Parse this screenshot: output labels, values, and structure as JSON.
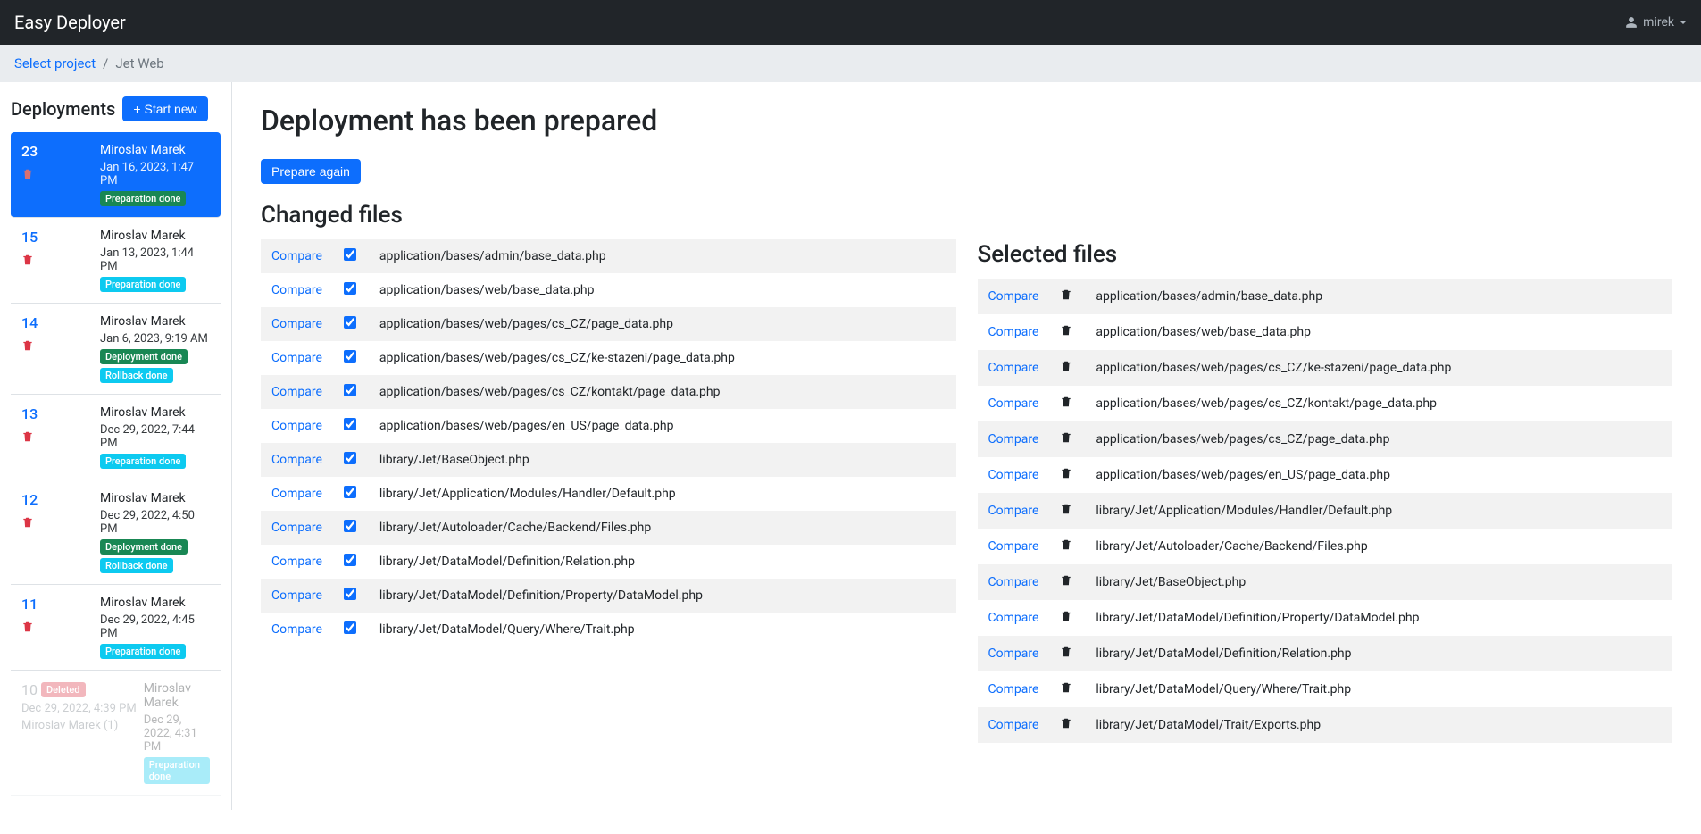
{
  "navbar": {
    "brand": "Easy Deployer",
    "user": "mirek"
  },
  "breadcrumb": {
    "select_project": "Select project",
    "separator": "/",
    "current": "Jet Web"
  },
  "sidebar": {
    "title": "Deployments",
    "start_new": "Start new",
    "deployments": [
      {
        "id": "23",
        "author": "Miroslav Marek",
        "date": "Jan 16, 2023, 1:47 PM",
        "badges": [
          {
            "text": "Preparation done",
            "cls": "badge-green"
          }
        ],
        "selected": true
      },
      {
        "id": "15",
        "author": "Miroslav Marek",
        "date": "Jan 13, 2023, 1:44 PM",
        "badges": [
          {
            "text": "Preparation done",
            "cls": "badge-teal"
          }
        ]
      },
      {
        "id": "14",
        "author": "Miroslav Marek",
        "date": "Jan 6, 2023, 9:19 AM",
        "badges": [
          {
            "text": "Deployment done",
            "cls": "badge-green"
          },
          {
            "text": "Rollback done",
            "cls": "badge-teal"
          }
        ]
      },
      {
        "id": "13",
        "author": "Miroslav Marek",
        "date": "Dec 29, 2022, 7:44 PM",
        "badges": [
          {
            "text": "Preparation done",
            "cls": "badge-teal"
          }
        ]
      },
      {
        "id": "12",
        "author": "Miroslav Marek",
        "date": "Dec 29, 2022, 4:50 PM",
        "badges": [
          {
            "text": "Deployment done",
            "cls": "badge-green"
          },
          {
            "text": "Rollback done",
            "cls": "badge-teal"
          }
        ]
      },
      {
        "id": "11",
        "author": "Miroslav Marek",
        "date": "Dec 29, 2022, 4:45 PM",
        "badges": [
          {
            "text": "Preparation done",
            "cls": "badge-teal"
          }
        ]
      }
    ],
    "deleted": {
      "id": "10",
      "deleted_label": "Deleted",
      "date": "Dec 29, 2022, 4:39 PM",
      "del_by": "Miroslav Marek (1)",
      "author": "Miroslav Marek",
      "author_date": "Dec 29, 2022, 4:31 PM",
      "badges": [
        {
          "text": "Preparation done",
          "cls": "badge-teal"
        }
      ]
    }
  },
  "main": {
    "title": "Deployment has been prepared",
    "prepare_again": "Prepare again",
    "changed_title": "Changed files",
    "selected_title": "Selected files",
    "compare_label": "Compare",
    "changed_files": [
      "application/bases/admin/base_data.php",
      "application/bases/web/base_data.php",
      "application/bases/web/pages/cs_CZ/page_data.php",
      "application/bases/web/pages/cs_CZ/ke-stazeni/page_data.php",
      "application/bases/web/pages/cs_CZ/kontakt/page_data.php",
      "application/bases/web/pages/en_US/page_data.php",
      "library/Jet/BaseObject.php",
      "library/Jet/Application/Modules/Handler/Default.php",
      "library/Jet/Autoloader/Cache/Backend/Files.php",
      "library/Jet/DataModel/Definition/Relation.php",
      "library/Jet/DataModel/Definition/Property/DataModel.php",
      "library/Jet/DataModel/Query/Where/Trait.php"
    ],
    "selected_files": [
      "application/bases/admin/base_data.php",
      "application/bases/web/base_data.php",
      "application/bases/web/pages/cs_CZ/ke-stazeni/page_data.php",
      "application/bases/web/pages/cs_CZ/kontakt/page_data.php",
      "application/bases/web/pages/cs_CZ/page_data.php",
      "application/bases/web/pages/en_US/page_data.php",
      "library/Jet/Application/Modules/Handler/Default.php",
      "library/Jet/Autoloader/Cache/Backend/Files.php",
      "library/Jet/BaseObject.php",
      "library/Jet/DataModel/Definition/Property/DataModel.php",
      "library/Jet/DataModel/Definition/Relation.php",
      "library/Jet/DataModel/Query/Where/Trait.php",
      "library/Jet/DataModel/Trait/Exports.php"
    ]
  }
}
